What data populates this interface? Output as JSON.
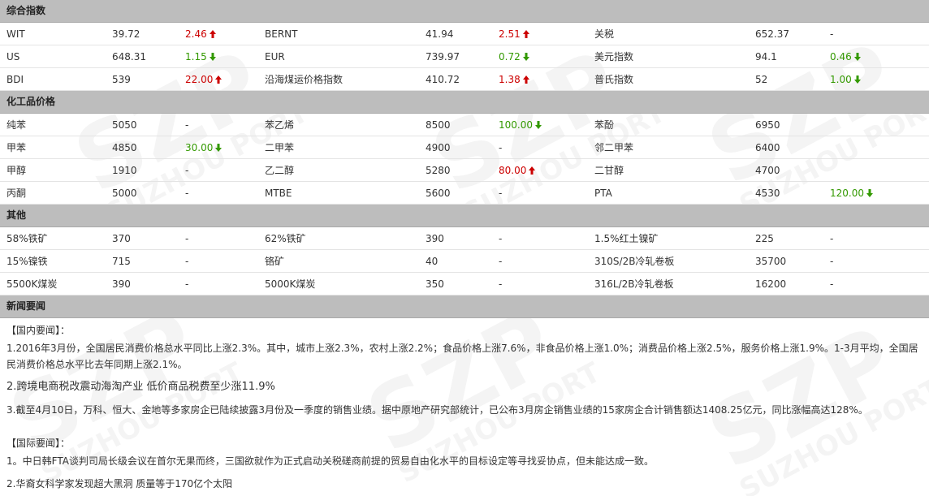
{
  "sections": {
    "composite": "综合指数",
    "chemical": "化工品价格",
    "other": "其他",
    "news": "新闻要闻"
  },
  "composite_rows": [
    [
      {
        "name": "WIT",
        "price": "39.72",
        "change": "2.46",
        "dir": "up"
      },
      {
        "name": "BERNT",
        "price": "41.94",
        "change": "2.51",
        "dir": "up"
      },
      {
        "name": "关税",
        "price": "652.37",
        "change": "-",
        "dir": "none"
      }
    ],
    [
      {
        "name": "US",
        "price": "648.31",
        "change": "1.15",
        "dir": "down"
      },
      {
        "name": "EUR",
        "price": "739.97",
        "change": "0.72",
        "dir": "down"
      },
      {
        "name": "美元指数",
        "price": "94.1",
        "change": "0.46",
        "dir": "down"
      }
    ],
    [
      {
        "name": "BDI",
        "price": "539",
        "change": "22.00",
        "dir": "up"
      },
      {
        "name": "沿海煤运价格指数",
        "price": "410.72",
        "change": "1.38",
        "dir": "up"
      },
      {
        "name": "普氏指数",
        "price": "52",
        "change": "1.00",
        "dir": "down"
      }
    ]
  ],
  "chemical_rows": [
    [
      {
        "name": "纯苯",
        "price": "5050",
        "change": "-",
        "dir": "none"
      },
      {
        "name": "苯乙烯",
        "price": "8500",
        "change": "100.00",
        "dir": "down"
      },
      {
        "name": "苯酚",
        "price": "6950",
        "change": "",
        "dir": "none"
      }
    ],
    [
      {
        "name": "甲苯",
        "price": "4850",
        "change": "30.00",
        "dir": "down"
      },
      {
        "name": "二甲苯",
        "price": "4900",
        "change": "-",
        "dir": "none"
      },
      {
        "name": "邻二甲苯",
        "price": "6400",
        "change": "",
        "dir": "none"
      }
    ],
    [
      {
        "name": "甲醇",
        "price": "1910",
        "change": "-",
        "dir": "none"
      },
      {
        "name": "乙二醇",
        "price": "5280",
        "change": "80.00",
        "dir": "up"
      },
      {
        "name": "二甘醇",
        "price": "4700",
        "change": "",
        "dir": "none"
      }
    ],
    [
      {
        "name": "丙酮",
        "price": "5000",
        "change": "-",
        "dir": "none"
      },
      {
        "name": "MTBE",
        "price": "5600",
        "change": "-",
        "dir": "none"
      },
      {
        "name": "PTA",
        "price": "4530",
        "change": "120.00",
        "dir": "down"
      }
    ]
  ],
  "other_rows": [
    [
      {
        "name": "58%铁矿",
        "price": "370",
        "change": "-",
        "dir": "none"
      },
      {
        "name": "62%铁矿",
        "price": "390",
        "change": "-",
        "dir": "none"
      },
      {
        "name": "1.5%红土镍矿",
        "price": "225",
        "change": "-",
        "dir": "none"
      }
    ],
    [
      {
        "name": "15%镍铁",
        "price": "715",
        "change": "-",
        "dir": "none"
      },
      {
        "name": "铬矿",
        "price": "40",
        "change": "-",
        "dir": "none"
      },
      {
        "name": "310S/2B冷轧卷板",
        "price": "35700",
        "change": "-",
        "dir": "none"
      }
    ],
    [
      {
        "name": "5500K煤炭",
        "price": "390",
        "change": "-",
        "dir": "none"
      },
      {
        "name": "5000K煤炭",
        "price": "350",
        "change": "-",
        "dir": "none"
      },
      {
        "name": "316L/2B冷轧卷板",
        "price": "16200",
        "change": "-",
        "dir": "none"
      }
    ]
  ],
  "news": {
    "domestic_heading": "【国内要闻】：",
    "domestic_items": [
      {
        "text": "1.2016年3月份，全国居民消费价格总水平同比上涨2.3%。其中，城市上涨2.3%，农村上涨2.2%；食品价格上涨7.6%，非食品价格上涨1.0%；消费品价格上涨2.5%，服务价格上涨1.9%。1-3月平均，全国居民消费价格总水平比去年同期上涨2.1%。",
        "big": false
      },
      {
        "text": "2.跨境电商税改震动海淘产业 低价商品税费至少涨11.9%",
        "big": true
      },
      {
        "text": "3.截至4月10日，万科、恒大、金地等多家房企已陆续披露3月份及一季度的销售业绩。据中原地产研究部统计，已公布3月房企销售业绩的15家房企合计销售额达1408.25亿元，同比涨幅高达128%。",
        "big": false
      }
    ],
    "intl_heading": "【国际要闻】：",
    "intl_items": [
      {
        "text": "1。中日韩FTA谈判司局长级会议在首尔无果而终，三国欲就作为正式启动关税磋商前提的贸易自由化水平的目标设定等寻找妥协点，但未能达成一致。"
      },
      {
        "text": "2.华裔女科学家发现超大黑洞 质量等于170亿个太阳"
      }
    ]
  },
  "watermark": {
    "brand": "SZP",
    "sub": "SUZHOU PORT"
  },
  "colors": {
    "up": "#cc0000",
    "down": "#339900",
    "header_bg": "#bdbdbd"
  }
}
